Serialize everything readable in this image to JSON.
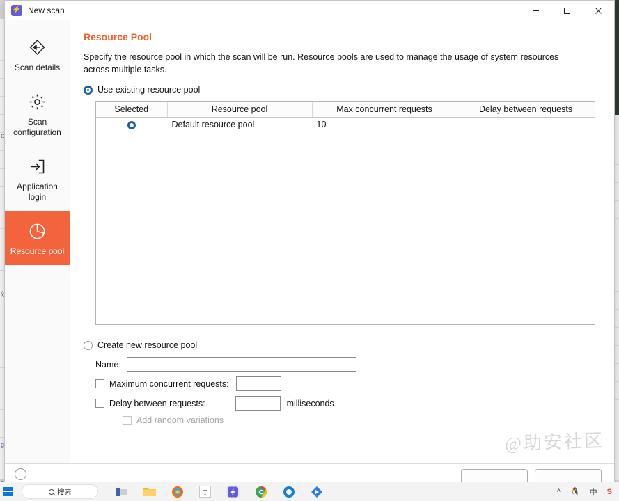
{
  "window": {
    "title": "New scan",
    "app_icon": "lightning-bolt-icon",
    "controls": {
      "minimize": "minimize-icon",
      "maximize": "maximize-icon",
      "close": "close-icon"
    }
  },
  "sidebar": {
    "items": [
      {
        "label": "Scan details",
        "icon": "scan-details-icon",
        "active": false
      },
      {
        "label": "Scan configuration",
        "icon": "gear-icon",
        "active": false
      },
      {
        "label": "Application login",
        "icon": "login-arrow-icon",
        "active": false
      },
      {
        "label": "Resource pool",
        "icon": "pie-chart-icon",
        "active": true
      }
    ]
  },
  "main": {
    "title": "Resource Pool",
    "description": "Specify the resource pool in which the scan will be run. Resource pools are used to manage the usage of system resources across multiple tasks.",
    "use_existing": {
      "label": "Use existing resource pool",
      "selected": true
    },
    "table": {
      "columns": [
        "Selected",
        "Resource pool",
        "Max concurrent requests",
        "Delay between requests"
      ],
      "rows": [
        {
          "selected": true,
          "resource_pool": "Default resource pool",
          "max_concurrent_requests": "10",
          "delay_between_requests": ""
        }
      ]
    },
    "create_new": {
      "label": "Create new resource pool",
      "selected": false,
      "name_label": "Name:",
      "name_value": "",
      "max_concurrent": {
        "label": "Maximum concurrent requests:",
        "checked": false,
        "value": ""
      },
      "delay": {
        "label": "Delay between requests:",
        "checked": false,
        "value": "",
        "unit": "milliseconds"
      },
      "random_variations": {
        "label": "Add random variations",
        "checked": false,
        "disabled": true
      }
    }
  },
  "watermark": {
    "text": "@助安社区"
  },
  "footer": {
    "help": "help-icon"
  },
  "taskbar": {
    "start": "start-icon",
    "search_placeholder": "搜索",
    "apps": [
      "task-view-icon",
      "file-explorer-icon",
      "firefox-icon",
      "text-editor-icon",
      "burp-suite-icon",
      "chrome-icon",
      "edge-icon",
      "potplayer-icon"
    ],
    "tray": [
      "chevron-up-icon",
      "qq-icon",
      "ime-chinese-icon",
      "sogou-icon"
    ],
    "ime_label": "中"
  },
  "colors": {
    "accent_orange": "#f4622e",
    "sidebar_active": "#f4643c",
    "radio_blue": "#1a5fa8"
  }
}
